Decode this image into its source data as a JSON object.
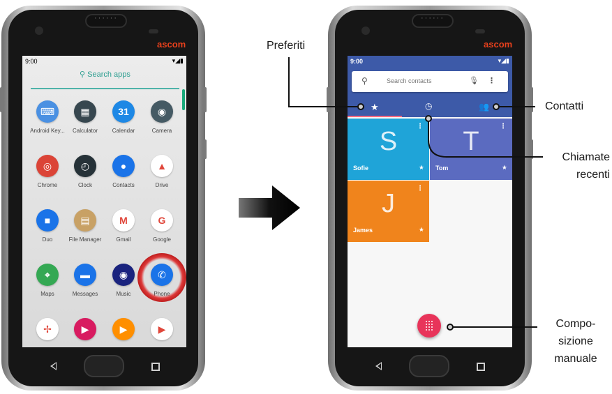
{
  "left_phone": {
    "brand": "ascom",
    "status": {
      "time": "9:00",
      "icons": "▾◢▮"
    },
    "search_label": "Search apps",
    "apps": [
      {
        "label": "Android Key...",
        "icon": "keyboard-icon",
        "color": "#4a90e2",
        "glyph": "⌨"
      },
      {
        "label": "Calculator",
        "icon": "calculator-icon",
        "color": "#37474f",
        "glyph": "▦"
      },
      {
        "label": "Calendar",
        "icon": "calendar-icon",
        "color": "#1e88e5",
        "glyph": "31"
      },
      {
        "label": "Camera",
        "icon": "camera-icon",
        "color": "#455a64",
        "glyph": "◉"
      },
      {
        "label": "Chrome",
        "icon": "chrome-icon",
        "color": "#db4437",
        "glyph": "◎"
      },
      {
        "label": "Clock",
        "icon": "clock-icon",
        "color": "#263238",
        "glyph": "◴"
      },
      {
        "label": "Contacts",
        "icon": "contacts-icon",
        "color": "#1a73e8",
        "glyph": "●"
      },
      {
        "label": "Drive",
        "icon": "drive-icon",
        "color": "#ffffff",
        "glyph": "▲"
      },
      {
        "label": "Duo",
        "icon": "duo-icon",
        "color": "#1a73e8",
        "glyph": "■"
      },
      {
        "label": "File Manager",
        "icon": "file-manager-icon",
        "color": "#c8a165",
        "glyph": "▤"
      },
      {
        "label": "Gmail",
        "icon": "gmail-icon",
        "color": "#ffffff",
        "glyph": "M"
      },
      {
        "label": "Google",
        "icon": "google-icon",
        "color": "#ffffff",
        "glyph": "G"
      },
      {
        "label": "Maps",
        "icon": "maps-icon",
        "color": "#34a853",
        "glyph": "⌖"
      },
      {
        "label": "Messages",
        "icon": "messages-icon",
        "color": "#1a73e8",
        "glyph": "▬"
      },
      {
        "label": "Music",
        "icon": "music-icon",
        "color": "#1a237e",
        "glyph": "◉"
      },
      {
        "label": "Phone",
        "icon": "phone-icon",
        "color": "#1a73e8",
        "glyph": "✆"
      },
      {
        "label": "",
        "icon": "photos-icon",
        "color": "#ffffff",
        "glyph": "✢"
      },
      {
        "label": "",
        "icon": "play-movies-icon",
        "color": "#d81b60",
        "glyph": "▶"
      },
      {
        "label": "",
        "icon": "play-music-icon",
        "color": "#ff8f00",
        "glyph": "▶"
      },
      {
        "label": "",
        "icon": "play-store-icon",
        "color": "#ffffff",
        "glyph": "▶"
      }
    ]
  },
  "right_phone": {
    "brand": "ascom",
    "status": {
      "time": "9:00",
      "icons": "▾◢▮"
    },
    "search_placeholder": "Search contacts",
    "contacts": [
      {
        "letter": "S",
        "name": "Sofie",
        "color": "#1fa4d8"
      },
      {
        "letter": "T",
        "name": "Tom",
        "color": "#5b6bc0"
      },
      {
        "letter": "J",
        "name": "James",
        "color": "#f0841c"
      }
    ],
    "colors": {
      "header": "#3d5aa8",
      "fab": "#e8345a"
    }
  },
  "annotations": {
    "preferiti": "Preferiti",
    "contatti": "Contatti",
    "chiamate_line1": "Chiamate",
    "chiamate_line2": "recenti",
    "compo_line1": "Compo-",
    "compo_line2": "sizione",
    "compo_line3": "manuale"
  }
}
